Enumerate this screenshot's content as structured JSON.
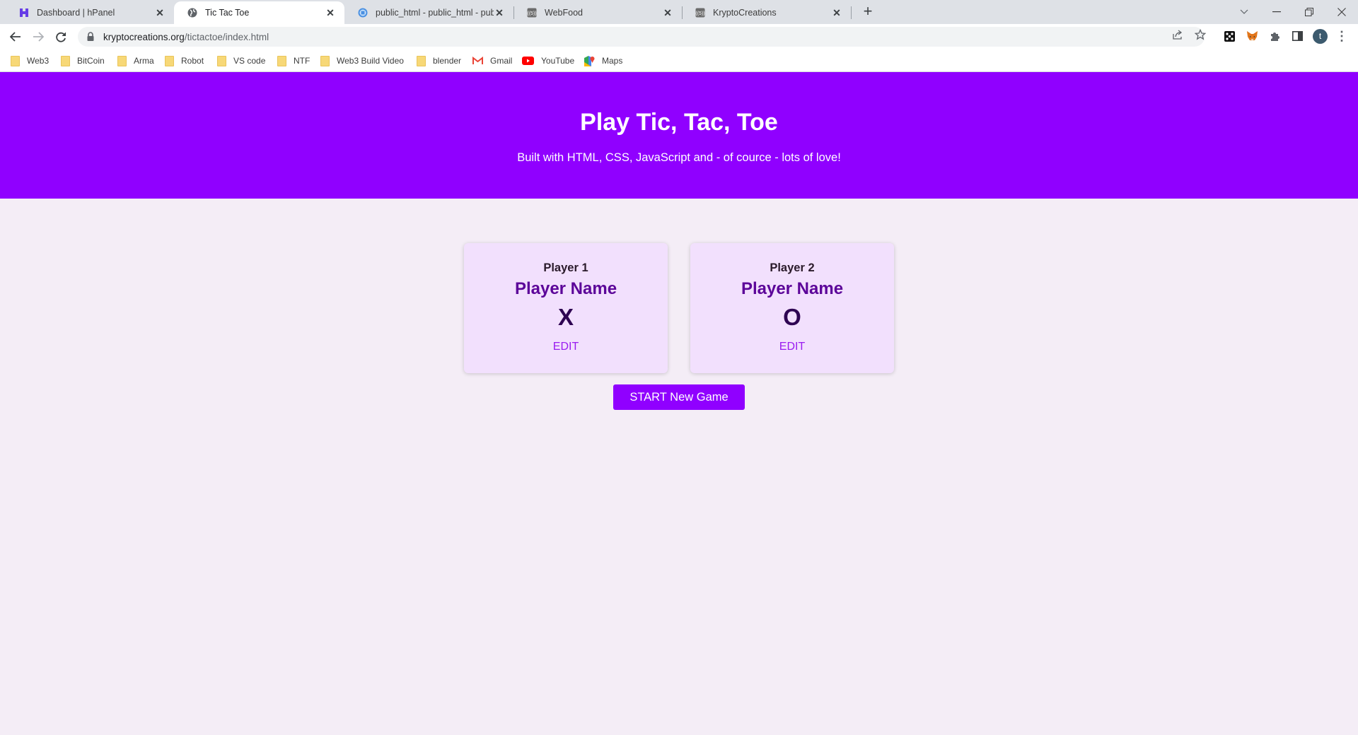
{
  "browser": {
    "tabs": [
      {
        "title": "Dashboard | hPanel",
        "icon": "hostinger-icon",
        "active": false
      },
      {
        "title": "Tic Tac Toe",
        "icon": "globe-icon",
        "active": true
      },
      {
        "title": "public_html - public_html - public",
        "icon": "file-manager-icon",
        "active": false
      },
      {
        "title": "WebFood",
        "icon": "broadcast-icon",
        "active": false
      },
      {
        "title": "KryptoCreations",
        "icon": "broadcast-icon",
        "active": false
      }
    ],
    "new_tab_label": "+",
    "address": {
      "host": "kryptocreations.org",
      "path": "/tictactoe/index.html"
    },
    "profile_initial": "t",
    "bookmarks": [
      {
        "label": "Web3",
        "type": "folder"
      },
      {
        "label": "BitCoin",
        "type": "folder"
      },
      {
        "label": "Arma",
        "type": "folder"
      },
      {
        "label": "Robot",
        "type": "folder"
      },
      {
        "label": "VS code",
        "type": "folder"
      },
      {
        "label": "NTF",
        "type": "folder"
      },
      {
        "label": "Web3 Build Video",
        "type": "folder"
      },
      {
        "label": "blender",
        "type": "folder"
      },
      {
        "label": "Gmail",
        "type": "gmail"
      },
      {
        "label": "YouTube",
        "type": "youtube"
      },
      {
        "label": "Maps",
        "type": "maps"
      }
    ]
  },
  "page": {
    "header": {
      "title": "Play Tic, Tac, Toe",
      "subtitle": "Built with HTML, CSS, JavaScript and - of cource - lots of love!"
    },
    "players": [
      {
        "label": "Player 1",
        "name": "Player Name",
        "symbol": "X",
        "edit_label": "EDIT"
      },
      {
        "label": "Player 2",
        "name": "Player Name",
        "symbol": "O",
        "edit_label": "EDIT"
      }
    ],
    "start_button": "START New Game",
    "colors": {
      "primary": "#9000ff",
      "background": "#f4edf6",
      "card": "#f2e0fd",
      "player_name": "#5c0599",
      "symbol": "#2e0452",
      "edit": "#9a1cf0"
    }
  }
}
